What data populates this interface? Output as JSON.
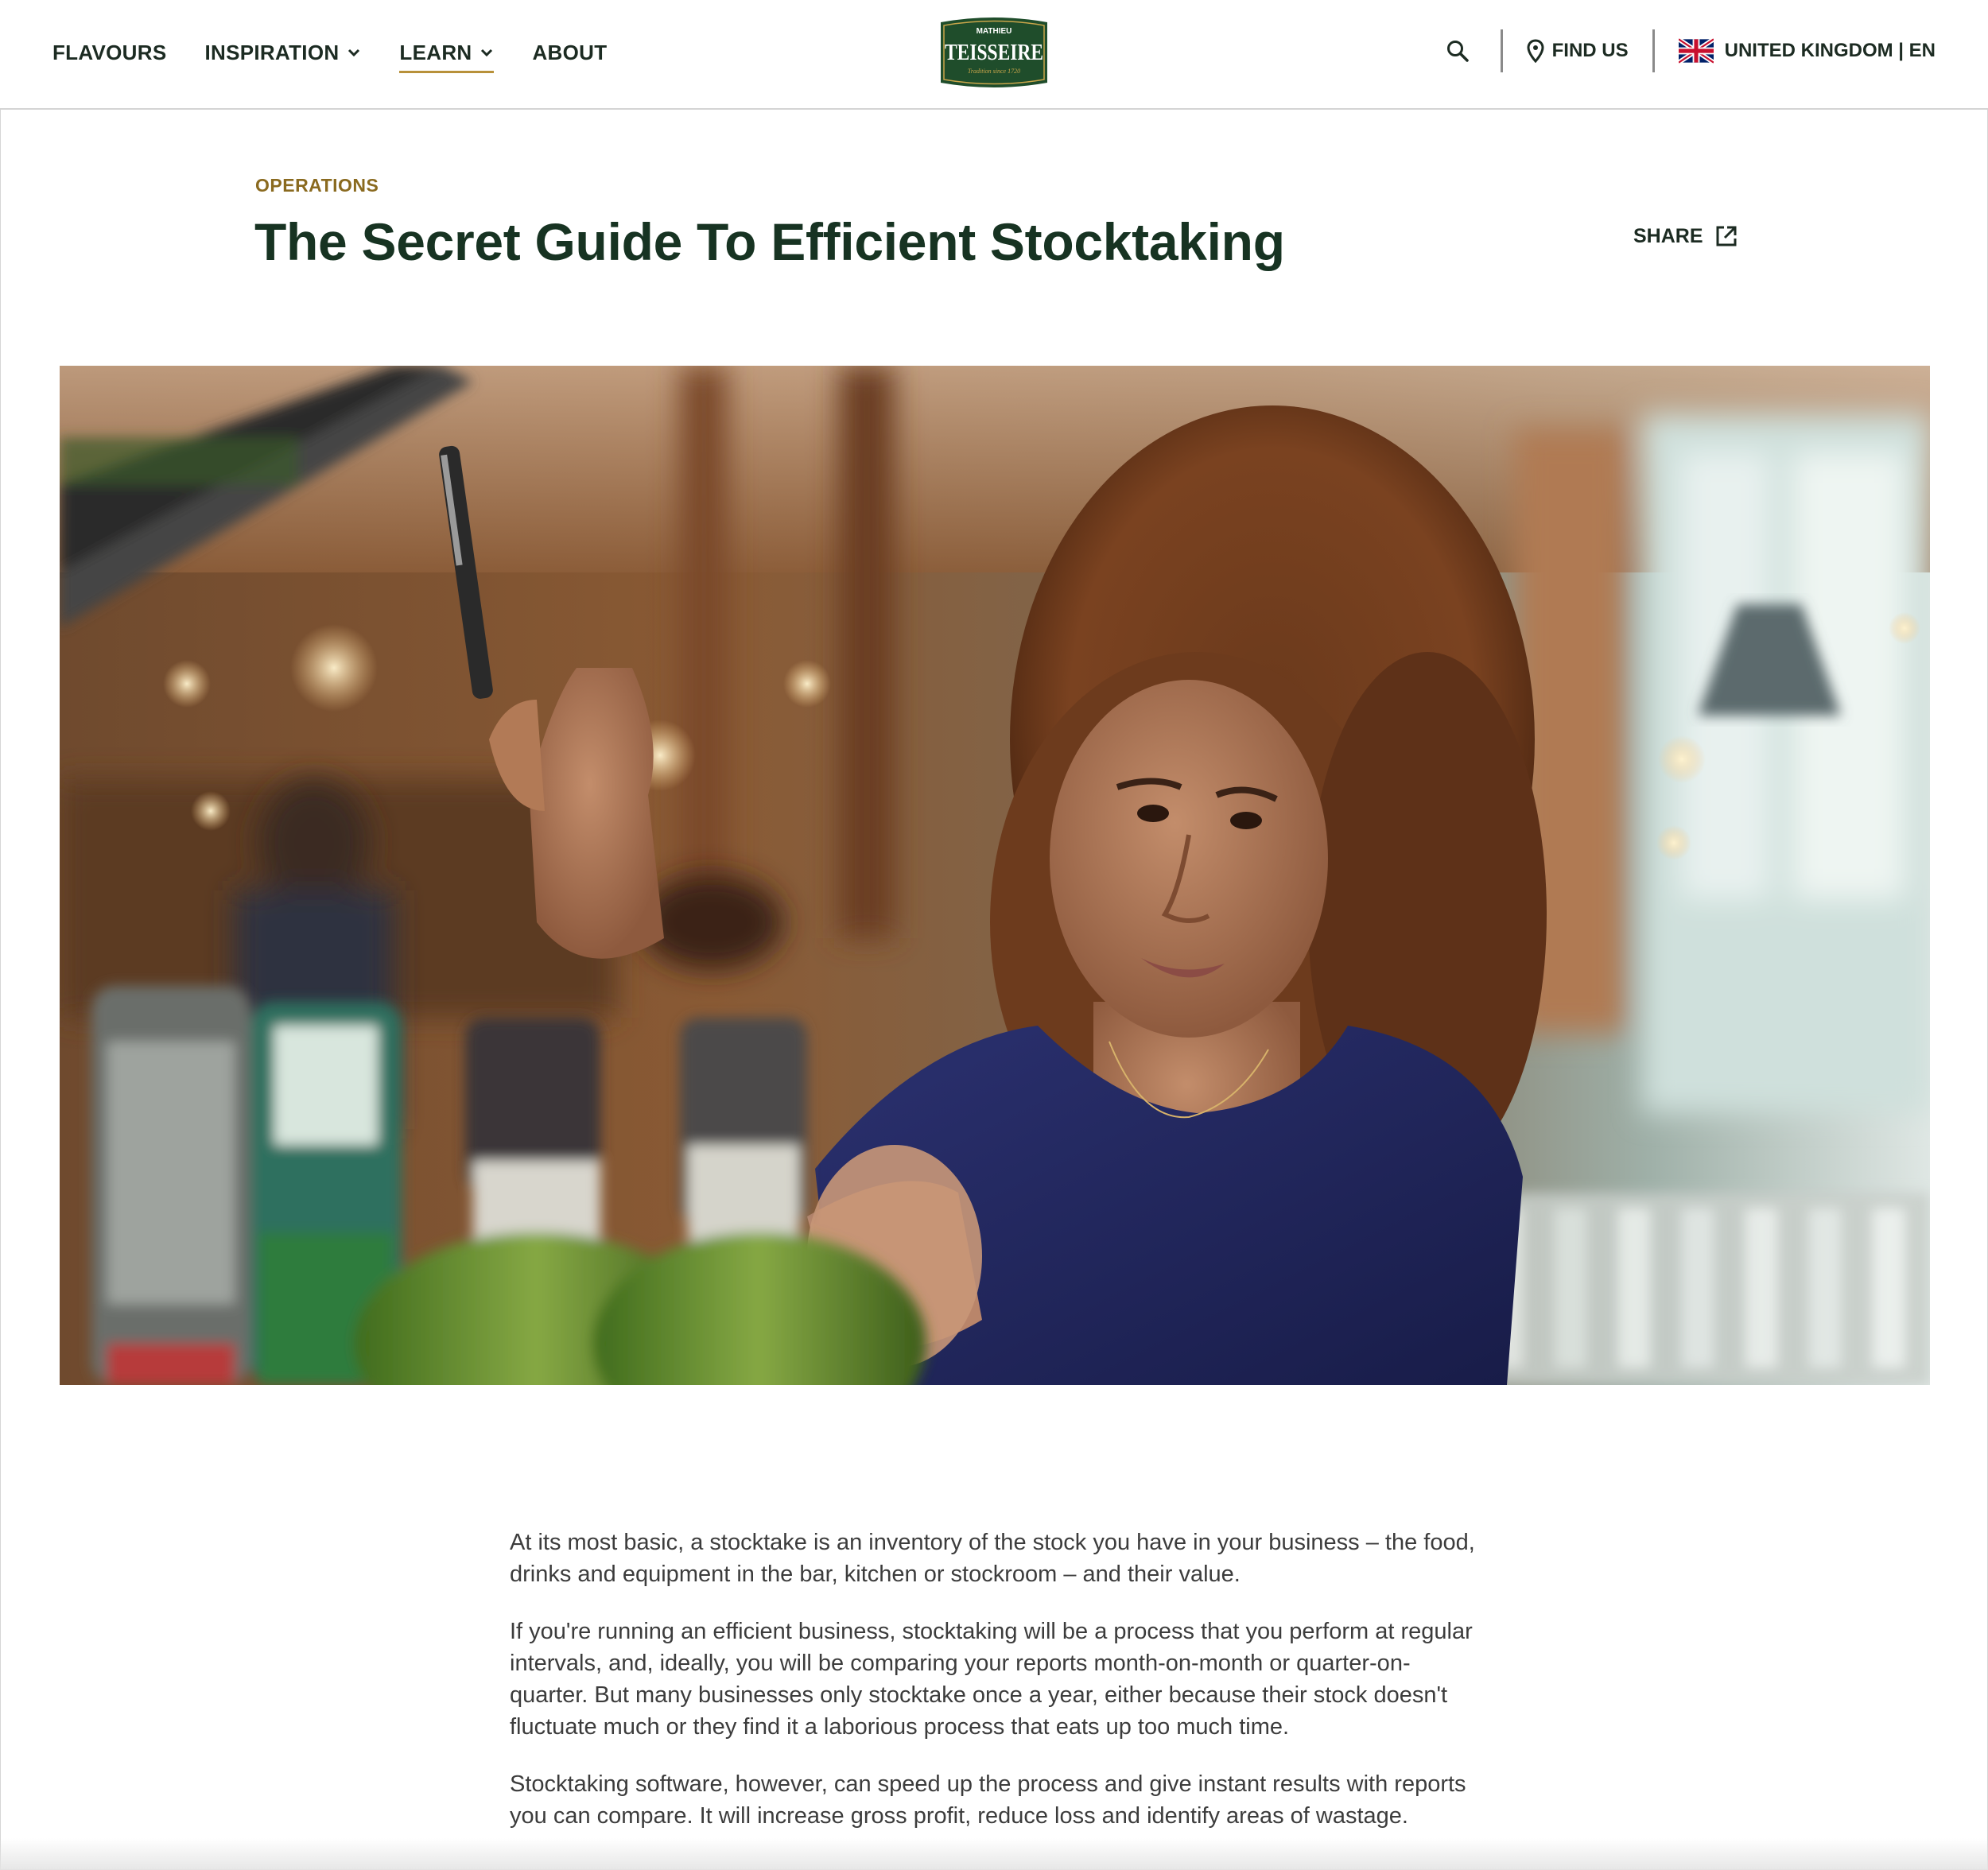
{
  "header": {
    "nav": [
      {
        "label": "FLAVOURS",
        "has_dropdown": false,
        "active": false
      },
      {
        "label": "INSPIRATION",
        "has_dropdown": true,
        "active": false
      },
      {
        "label": "LEARN",
        "has_dropdown": true,
        "active": true
      },
      {
        "label": "ABOUT",
        "has_dropdown": false,
        "active": false
      }
    ],
    "logo": {
      "top_text": "MATHIEU",
      "main_text": "TEISSEIRE",
      "tagline": "Tradition since 1720",
      "color": "#1f4d2b",
      "accent": "#c9a54a"
    },
    "find_us_label": "FIND US",
    "locale_label": "UNITED KINGDOM | EN"
  },
  "article": {
    "category": "OPERATIONS",
    "title": "The Secret Guide To Efficient Stocktaking",
    "share_label": "SHARE",
    "paragraphs": [
      "At its most basic, a stocktake is an inventory of the stock you have in your business – the food, drinks and equipment in the bar, kitchen or stockroom – and their value.",
      "If you're running an efficient business, stocktaking will be a process that you perform at regular intervals, and, ideally, you will be comparing your reports month-on-month or quarter-on-quarter. But many businesses only stocktake once a year, either because their stock doesn't fluctuate much or they find it a laborious process that eats up too much time.",
      "Stocktaking software, however, can speed up the process and give instant results with reports you can compare. It will increase gross profit, reduce loss and identify areas of wastage."
    ]
  },
  "colors": {
    "title": "#173322",
    "kicker": "#8a6a1f",
    "nav_text": "#1c2b22",
    "active_underline": "#b8913a",
    "body_text": "#3c3c3c"
  },
  "icons": {
    "search": "search-icon",
    "location": "map-pin-icon",
    "flag": "uk-flag-icon",
    "share": "external-link-icon",
    "chevron": "chevron-down-icon"
  }
}
